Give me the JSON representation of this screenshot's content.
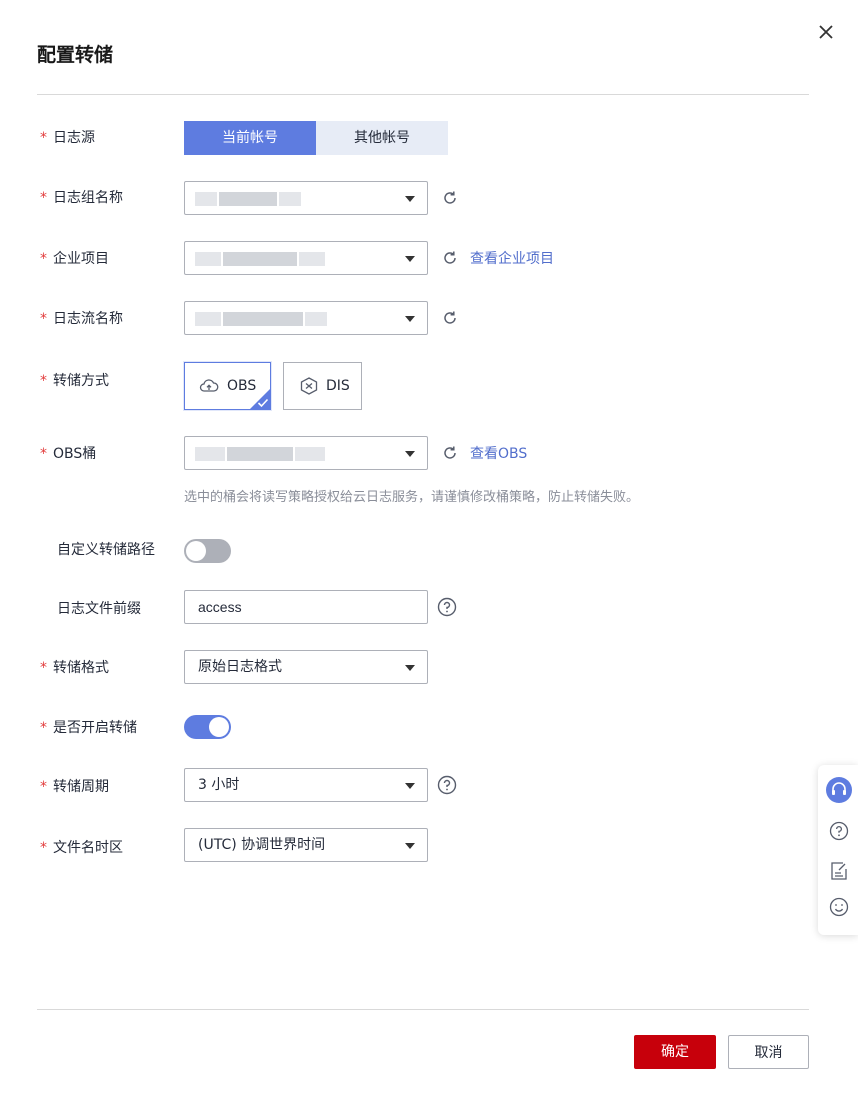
{
  "dialog": {
    "title": "配置转储",
    "fields": {
      "log_source": {
        "label": "日志源",
        "options": [
          "当前帐号",
          "其他帐号"
        ],
        "selected": "当前帐号"
      },
      "log_group": {
        "label": "日志组名称"
      },
      "enterprise_project": {
        "label": "企业项目",
        "link": "查看企业项目"
      },
      "log_stream": {
        "label": "日志流名称"
      },
      "transfer_mode": {
        "label": "转储方式",
        "options": [
          "OBS",
          "DIS"
        ],
        "selected": "OBS"
      },
      "obs_bucket": {
        "label": "OBS桶",
        "link": "查看OBS",
        "hint": "选中的桶会将读写策略授权给云日志服务，请谨慎修改桶策略，防止转储失败。"
      },
      "custom_path": {
        "label": "自定义转储路径",
        "enabled": false
      },
      "file_prefix": {
        "label": "日志文件前缀",
        "value": "access"
      },
      "transfer_format": {
        "label": "转储格式",
        "value": "原始日志格式"
      },
      "enable_transfer": {
        "label": "是否开启转储",
        "enabled": true
      },
      "transfer_period": {
        "label": "转储周期",
        "value": "3 小时"
      },
      "filename_timezone": {
        "label": "文件名时区",
        "value": "(UTC) 协调世界时间"
      }
    },
    "footer": {
      "confirm_label": "确定",
      "cancel_label": "取消"
    }
  },
  "icons": {
    "close": "close-icon",
    "refresh": "refresh-icon",
    "help": "question-icon",
    "chevron": "chevron-down-icon",
    "cloud": "cloud-upload-icon",
    "dis": "hexagon-icon",
    "headset": "headset-icon",
    "feedback": "edit-note-icon",
    "smile": "smile-icon"
  },
  "colors": {
    "primary": "#5e7ce0",
    "danger_button": "#c7000b",
    "required_star": "#e23b3b",
    "link": "#526ecc"
  }
}
